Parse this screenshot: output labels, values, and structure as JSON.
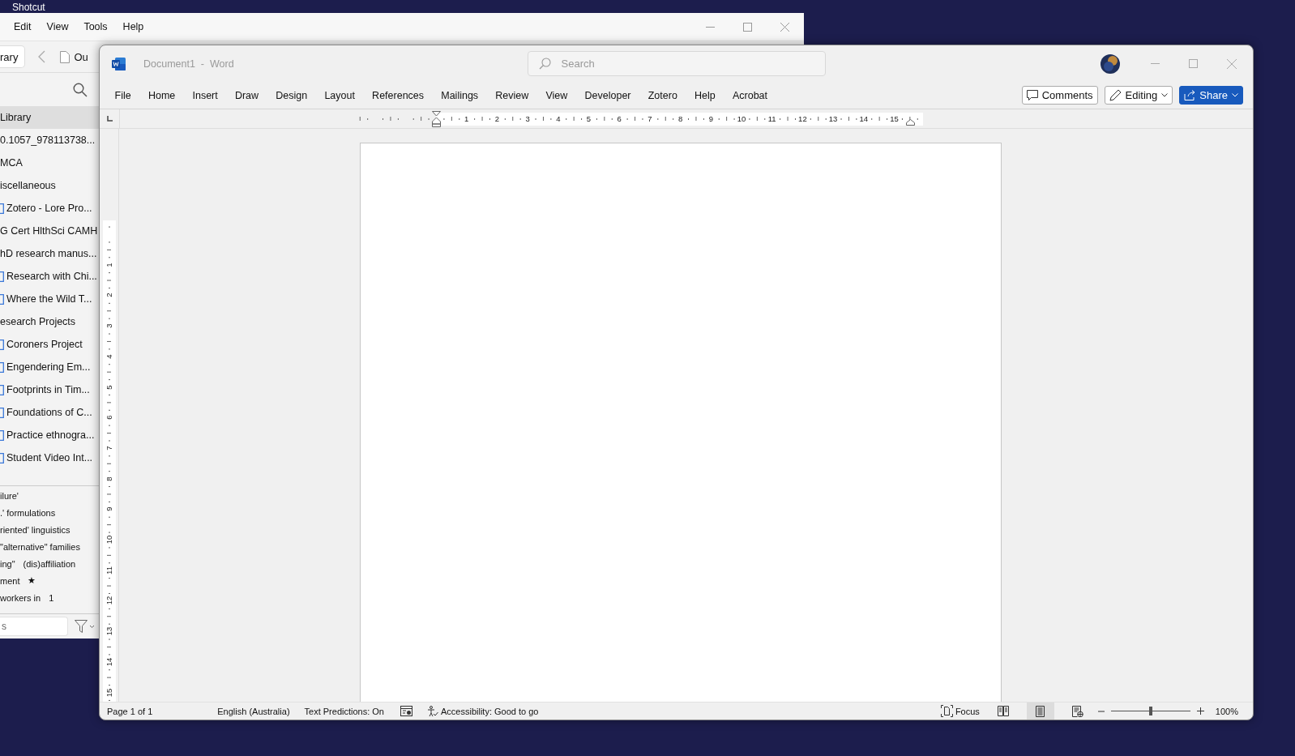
{
  "desktop": {
    "icon_label": "Shotcut"
  },
  "zotero": {
    "menu": [
      "Edit",
      "View",
      "Tools",
      "Help"
    ],
    "library_tab": "rary",
    "open_tab": "Ou",
    "collections": [
      {
        "label": "Library",
        "kind": "plain",
        "selected": true
      },
      {
        "label": "0.1057_978113738...",
        "kind": "plain",
        "selected": false
      },
      {
        "label": "MCA",
        "kind": "plain",
        "selected": false
      },
      {
        "label": "iscellaneous",
        "kind": "plain",
        "selected": false
      },
      {
        "label": "Zotero - Lore Pro...",
        "kind": "folder",
        "selected": false
      },
      {
        "label": "G Cert HlthSci CAMH",
        "kind": "plain",
        "selected": false
      },
      {
        "label": "hD research manus...",
        "kind": "plain",
        "selected": false
      },
      {
        "label": "Research with Chi...",
        "kind": "folder",
        "selected": false
      },
      {
        "label": "Where the Wild T...",
        "kind": "folder",
        "selected": false
      },
      {
        "label": "esearch Projects",
        "kind": "plain",
        "selected": false
      },
      {
        "label": "Coroners Project",
        "kind": "folder",
        "selected": false
      },
      {
        "label": "Engendering Em...",
        "kind": "folder",
        "selected": false
      },
      {
        "label": "Footprints in Tim...",
        "kind": "folder",
        "selected": false
      },
      {
        "label": "Foundations of C...",
        "kind": "folder",
        "selected": false
      },
      {
        "label": "Practice ethnogra...",
        "kind": "folder",
        "selected": false
      },
      {
        "label": "Student Video Int...",
        "kind": "folder",
        "selected": false
      }
    ],
    "tags": [
      [
        "ilure'"
      ],
      [
        ".' formulations"
      ],
      [
        "riented' linguistics"
      ],
      [
        "\"alternative\" families"
      ],
      [
        "ing\"",
        "(dis)affiliation"
      ],
      [
        "ment",
        "★"
      ],
      [
        "workers in",
        "1"
      ]
    ],
    "filter": {
      "placeholder": "s"
    }
  },
  "word": {
    "title": "Document1  -  Word",
    "search": {
      "placeholder": "Search"
    },
    "tabs": [
      "File",
      "Home",
      "Insert",
      "Draw",
      "Design",
      "Layout",
      "References",
      "Mailings",
      "Review",
      "View",
      "Developer",
      "Zotero",
      "Help",
      "Acrobat"
    ],
    "buttons": [
      {
        "label": "Comments",
        "kind": "comments"
      },
      {
        "label": "Editing",
        "kind": "editing"
      },
      {
        "label": "Share",
        "kind": "share"
      }
    ],
    "horizontal_ruler": [
      "1",
      "2",
      "3",
      "4",
      "5",
      "6",
      "7",
      "8",
      "9",
      "10",
      "11",
      "12",
      "13",
      "14",
      "15"
    ],
    "vertical_ruler": [
      "1",
      "2",
      "3",
      "4",
      "5",
      "6",
      "7",
      "8",
      "9",
      "10",
      "11",
      "12",
      "13",
      "14",
      "15"
    ],
    "status_bar": {
      "page": "Page 1 of 1",
      "language": "English (Australia)",
      "predictions": "Text Predictions: On",
      "accessibility": "Accessibility: Good to go",
      "focus": "Focus",
      "views": [
        {
          "kind": "read",
          "selected": false
        },
        {
          "kind": "print",
          "selected": true
        },
        {
          "kind": "web",
          "selected": false
        }
      ],
      "zoom": {
        "level": 0.5,
        "reading": "100%"
      }
    }
  }
}
